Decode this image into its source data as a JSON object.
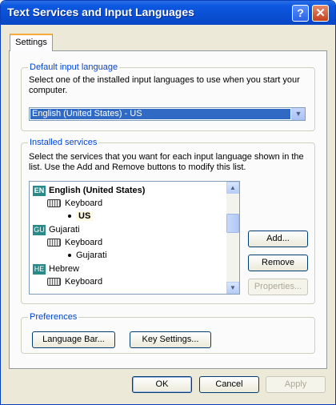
{
  "window": {
    "title": "Text Services and Input Languages",
    "help_glyph": "?",
    "close_glyph": "✕"
  },
  "tabs": [
    {
      "label": "Settings"
    }
  ],
  "default_input": {
    "legend": "Default input language",
    "description": "Select one of the installed input languages to use when you start your computer.",
    "selected": "English (United States) - US",
    "dropdown_glyph": "▼"
  },
  "installed": {
    "legend": "Installed services",
    "description": "Select the services that you want for each input language shown in the list. Use the Add and Remove buttons to modify this list.",
    "tree": [
      {
        "badge": "EN",
        "language": "English (United States)",
        "service": "Keyboard",
        "layout": "US"
      },
      {
        "badge": "GU",
        "language": "Gujarati",
        "service": "Keyboard",
        "layout": "Gujarati"
      },
      {
        "badge": "HE",
        "language": "Hebrew",
        "service": "Keyboard"
      }
    ],
    "scroll_up": "▲",
    "scroll_down": "▼",
    "buttons": {
      "add": "Add...",
      "remove": "Remove",
      "properties": "Properties..."
    }
  },
  "preferences": {
    "legend": "Preferences",
    "language_bar": "Language Bar...",
    "key_settings": "Key Settings..."
  },
  "footer": {
    "ok": "OK",
    "cancel": "Cancel",
    "apply": "Apply"
  }
}
